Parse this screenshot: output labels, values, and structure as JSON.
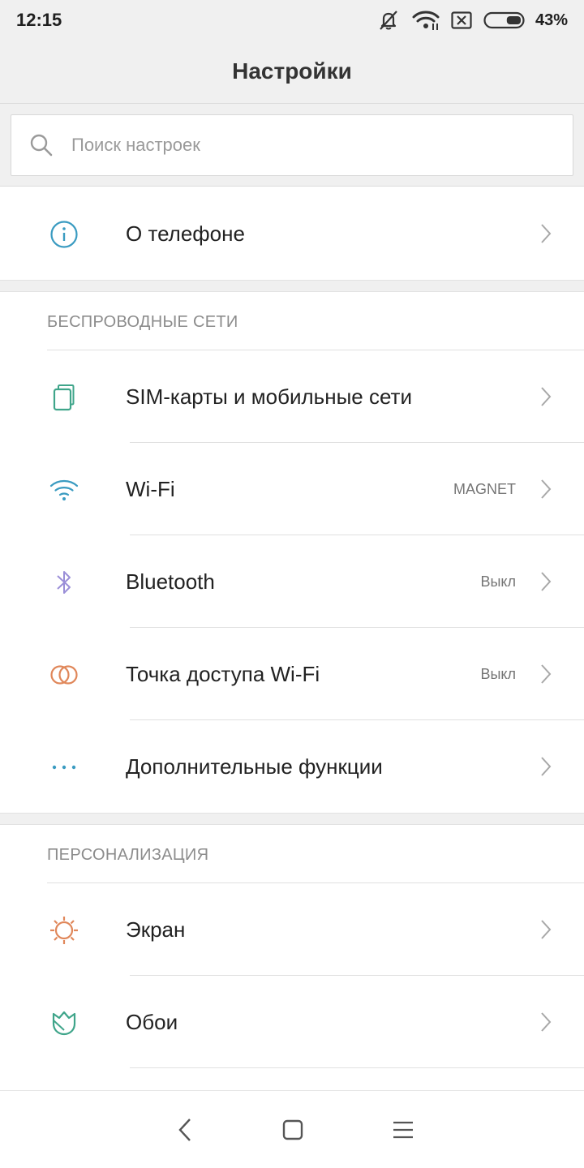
{
  "status_bar": {
    "time": "12:15",
    "battery_percent": "43%",
    "battery_level": 0.43,
    "icons": [
      "silent-icon",
      "wifi-icon",
      "sim-none-icon",
      "battery-icon"
    ]
  },
  "header": {
    "title": "Настройки"
  },
  "search": {
    "placeholder": "Поиск настроек",
    "value": ""
  },
  "top_items": [
    {
      "label": "О телефоне",
      "icon": "info-icon",
      "value": ""
    }
  ],
  "sections": {
    "wireless": {
      "header": "БЕСПРОВОДНЫЕ СЕТИ",
      "items": [
        {
          "label": "SIM-карты и мобильные сети",
          "icon": "sim-cards-icon",
          "value": ""
        },
        {
          "label": "Wi-Fi",
          "icon": "wifi-icon",
          "value": "MAGNET"
        },
        {
          "label": "Bluetooth",
          "icon": "bluetooth-icon",
          "value": "Выкл"
        },
        {
          "label": "Точка доступа Wi-Fi",
          "icon": "hotspot-icon",
          "value": "Выкл"
        },
        {
          "label": "Дополнительные функции",
          "icon": "more-dots-icon",
          "value": ""
        }
      ]
    },
    "personalization": {
      "header": "ПЕРСОНАЛИЗАЦИЯ",
      "items": [
        {
          "label": "Экран",
          "icon": "brightness-icon",
          "value": ""
        },
        {
          "label": "Обои",
          "icon": "wallpaper-icon",
          "value": ""
        }
      ]
    }
  },
  "nav_bar": {
    "buttons": [
      "back-icon",
      "home-icon",
      "menu-icon"
    ]
  },
  "colors": {
    "background_gray": "#f0f0f0",
    "info_icon": "#3a9bc1",
    "sim_icon": "#3fa58a",
    "wifi_icon": "#3a9bc1",
    "bluetooth_icon": "#9b8fd8",
    "hotspot_icon": "#e0875a",
    "more_icon": "#3a9bc1",
    "brightness_icon": "#e0875a",
    "wallpaper_icon": "#3fa58a"
  }
}
